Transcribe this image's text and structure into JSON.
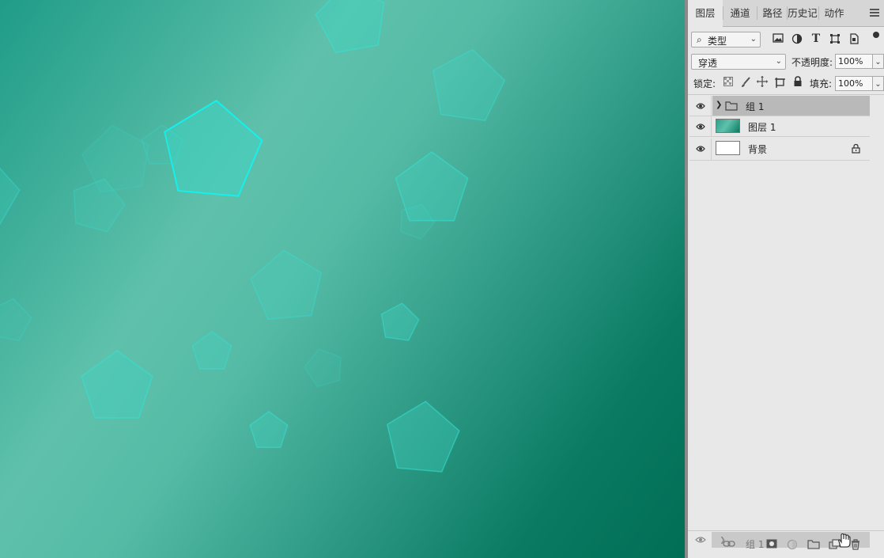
{
  "canvas": {
    "gradient_colors": [
      "#1f9c88",
      "#5fc1ab",
      "#0a7a62",
      "#006e55"
    ],
    "shape_fill": "#3fd3c2",
    "shape_stroke": "#33e3d6",
    "highlight_stroke": "#12f2ee"
  },
  "panel": {
    "tabs": [
      {
        "label": "图层",
        "active": true
      },
      {
        "label": "通道",
        "active": false
      },
      {
        "label": "路径",
        "active": false
      },
      {
        "label": "历史记",
        "active": false
      },
      {
        "label": "动作",
        "active": false
      }
    ],
    "filter": {
      "search_icon": "magnifier-icon",
      "value": "类型"
    },
    "filter_icons": [
      "image-filter-icon",
      "adjustment-filter-icon",
      "type-filter-icon",
      "shape-filter-icon",
      "smart-object-filter-icon"
    ],
    "blend_mode": "穿透",
    "opacity": {
      "label": "不透明度:",
      "value": "100%"
    },
    "lock": {
      "label": "锁定:",
      "icons": [
        "lock-transparent-icon",
        "lock-image-icon",
        "lock-position-icon",
        "lock-artboard-icon",
        "lock-all-icon"
      ]
    },
    "fill": {
      "label": "填充:",
      "value": "100%"
    },
    "layers": [
      {
        "name": "组 1",
        "type": "group",
        "visible": true,
        "selected": true
      },
      {
        "name": "图层 1",
        "type": "layer",
        "visible": true,
        "selected": false
      },
      {
        "name": "背景",
        "type": "background",
        "visible": true,
        "selected": false,
        "locked": true
      }
    ],
    "drag_ghost": {
      "name": "组 1"
    },
    "bottom_icons": [
      "link-layers-icon",
      "fx-icon",
      "add-mask-icon",
      "adjustment-layer-icon",
      "new-group-icon",
      "new-layer-icon",
      "delete-icon"
    ],
    "colors": {
      "panel_bg": "#e8e8e8",
      "selected_row": "#b9b9b9",
      "tab_bar": "#d6d6d6"
    }
  }
}
